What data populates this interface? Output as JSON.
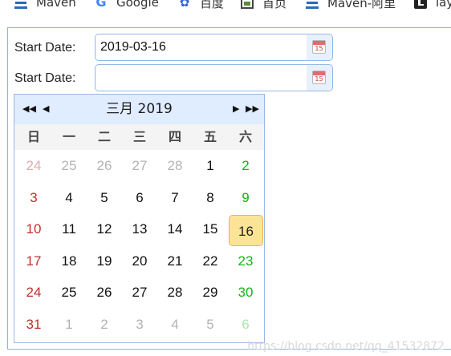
{
  "bookmarks": [
    {
      "label": "Maven",
      "icon": "maven-icon"
    },
    {
      "label": "Google",
      "icon": "google-icon"
    },
    {
      "label": "百度",
      "icon": "baidu-icon"
    },
    {
      "label": "首页",
      "icon": "home-icon"
    },
    {
      "label": "Maven-阿里",
      "icon": "maven-icon"
    },
    {
      "label": "lay",
      "icon": "layui-icon"
    }
  ],
  "form": {
    "row1": {
      "label": "Start Date:",
      "value": "2019-03-16"
    },
    "row2": {
      "label": "Start Date:",
      "value": ""
    }
  },
  "calendar": {
    "title": "三月 2019",
    "nav": {
      "prev_year": "◀◀",
      "prev_month": "◀",
      "next_month": "▶",
      "next_year": "▶▶"
    },
    "weekdays": [
      "日",
      "一",
      "二",
      "三",
      "四",
      "五",
      "六"
    ],
    "weeks": [
      [
        "24",
        "25",
        "26",
        "27",
        "28",
        "1",
        "2"
      ],
      [
        "3",
        "4",
        "5",
        "6",
        "7",
        "8",
        "9"
      ],
      [
        "10",
        "11",
        "12",
        "13",
        "14",
        "15",
        "16"
      ],
      [
        "17",
        "18",
        "19",
        "20",
        "21",
        "22",
        "23"
      ],
      [
        "24",
        "25",
        "26",
        "27",
        "28",
        "29",
        "30"
      ],
      [
        "31",
        "1",
        "2",
        "3",
        "4",
        "5",
        "6"
      ]
    ],
    "selected": "16",
    "colors": {
      "sunday": "#c0302e",
      "saturday": "#10b810",
      "selected_bg": "#fbe496",
      "header_bg": "#e0ecff"
    }
  },
  "watermark": "https://blog.csdn.net/qq_41532872"
}
